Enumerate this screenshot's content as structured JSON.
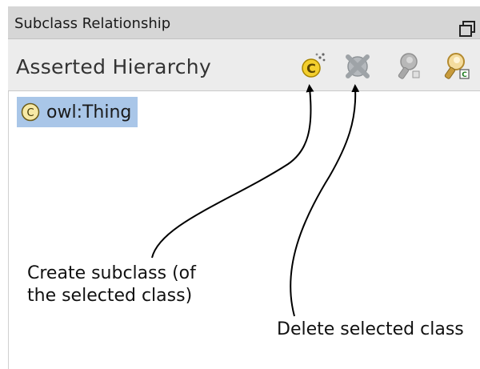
{
  "panel": {
    "title": "Subclass Relationship",
    "hierarchy_title": "Asserted Hierarchy"
  },
  "toolbar": {
    "tools": [
      {
        "icon": "create-subclass-icon"
      },
      {
        "icon": "delete-class-icon"
      },
      {
        "icon": "key-icon"
      },
      {
        "icon": "find-class-icon"
      }
    ]
  },
  "tree": {
    "items": [
      {
        "label": "owl:Thing",
        "selected": true
      }
    ]
  },
  "annotations": {
    "create_line1": "Create subclass (of",
    "create_line2": "the selected class)",
    "delete": "Delete selected class"
  },
  "colors": {
    "selection": "#a9c6e8",
    "toolbar_bg": "#ececec",
    "title_bg": "#d6d6d6"
  }
}
